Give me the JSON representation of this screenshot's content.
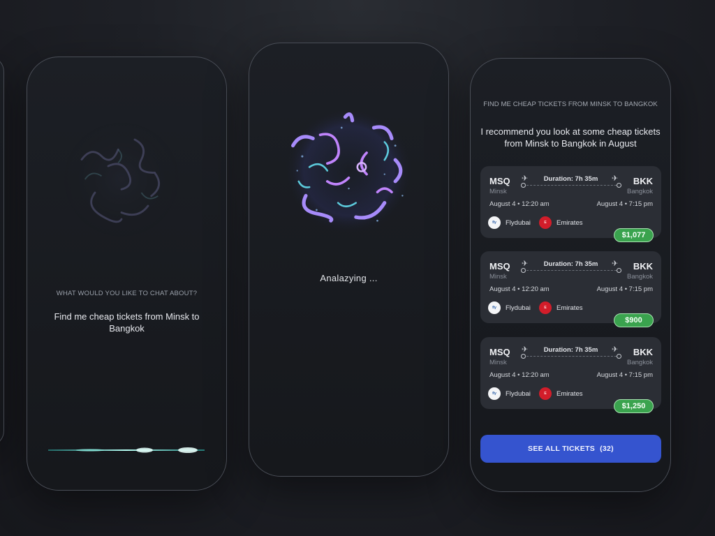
{
  "screen_chat": {
    "caption": "WHAT WOULD YOU LIKE TO CHAT ABOUT?",
    "prompt": "Find me cheap tickets from Minsk to Bangkok"
  },
  "screen_analyzing": {
    "status": "Analazying ..."
  },
  "screen_results": {
    "query": "FIND ME CHEAP TICKETS FROM MINSK TO BANGKOK",
    "answer": "I recommend you look at some cheap tickets from Minsk to Bangkok in August",
    "tickets": [
      {
        "from_code": "MSQ",
        "from_city": "Minsk",
        "to_code": "BKK",
        "to_city": "Bangkok",
        "duration": "Duration: 7h 35m",
        "depart": "August 4 • 12:20 am",
        "arrive": "August 4 • 7:15 pm",
        "airline1": "Flydubai",
        "airline2": "Emirates",
        "price": "$1,077"
      },
      {
        "from_code": "MSQ",
        "from_city": "Minsk",
        "to_code": "BKK",
        "to_city": "Bangkok",
        "duration": "Duration: 7h 35m",
        "depart": "August 4 • 12:20 am",
        "arrive": "August 4 • 7:15 pm",
        "airline1": "Flydubai",
        "airline2": "Emirates",
        "price": "$900"
      },
      {
        "from_code": "MSQ",
        "from_city": "Minsk",
        "to_code": "BKK",
        "to_city": "Bangkok",
        "duration": "Duration: 7h 35m",
        "depart": "August 4 • 12:20 am",
        "arrive": "August 4 • 7:15 pm",
        "airline1": "Flydubai",
        "airline2": "Emirates",
        "price": "$1,250"
      }
    ],
    "see_all_label": "SEE ALL TICKETS",
    "see_all_count": "(32)"
  },
  "icons": {
    "depart": "plane-takeoff-icon",
    "arrive": "plane-landing-icon"
  },
  "colors": {
    "accent_button": "#3554cf",
    "price_badge": "#3aa34e",
    "orb_purple": "#8b5cf6",
    "orb_cyan": "#67e8f9"
  }
}
